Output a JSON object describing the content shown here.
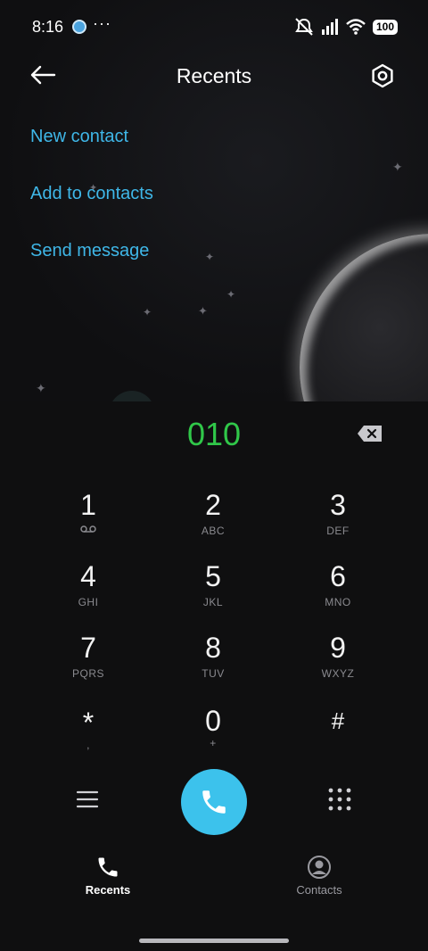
{
  "status_bar": {
    "time": "8:16",
    "more": "···",
    "battery": "100"
  },
  "header": {
    "title": "Recents"
  },
  "actions": [
    {
      "label": "New contact"
    },
    {
      "label": "Add to contacts"
    },
    {
      "label": "Send message"
    }
  ],
  "dialer": {
    "number": "010"
  },
  "keypad": [
    {
      "digit": "1",
      "letters": ""
    },
    {
      "digit": "2",
      "letters": "ABC"
    },
    {
      "digit": "3",
      "letters": "DEF"
    },
    {
      "digit": "4",
      "letters": "GHI"
    },
    {
      "digit": "5",
      "letters": "JKL"
    },
    {
      "digit": "6",
      "letters": "MNO"
    },
    {
      "digit": "7",
      "letters": "PQRS"
    },
    {
      "digit": "8",
      "letters": "TUV"
    },
    {
      "digit": "9",
      "letters": "WXYZ"
    },
    {
      "digit": "*",
      "letters": ","
    },
    {
      "digit": "0",
      "letters": "+"
    },
    {
      "digit": "#",
      "letters": ""
    }
  ],
  "tabs": [
    {
      "label": "Recents",
      "icon": "phone-icon",
      "active": true
    },
    {
      "label": "Contacts",
      "icon": "person-icon",
      "active": false
    }
  ],
  "colors": {
    "accent": "#3fb7e8",
    "number": "#30c749",
    "call_button": "#3cc2ec",
    "background": "#0f0f10"
  }
}
